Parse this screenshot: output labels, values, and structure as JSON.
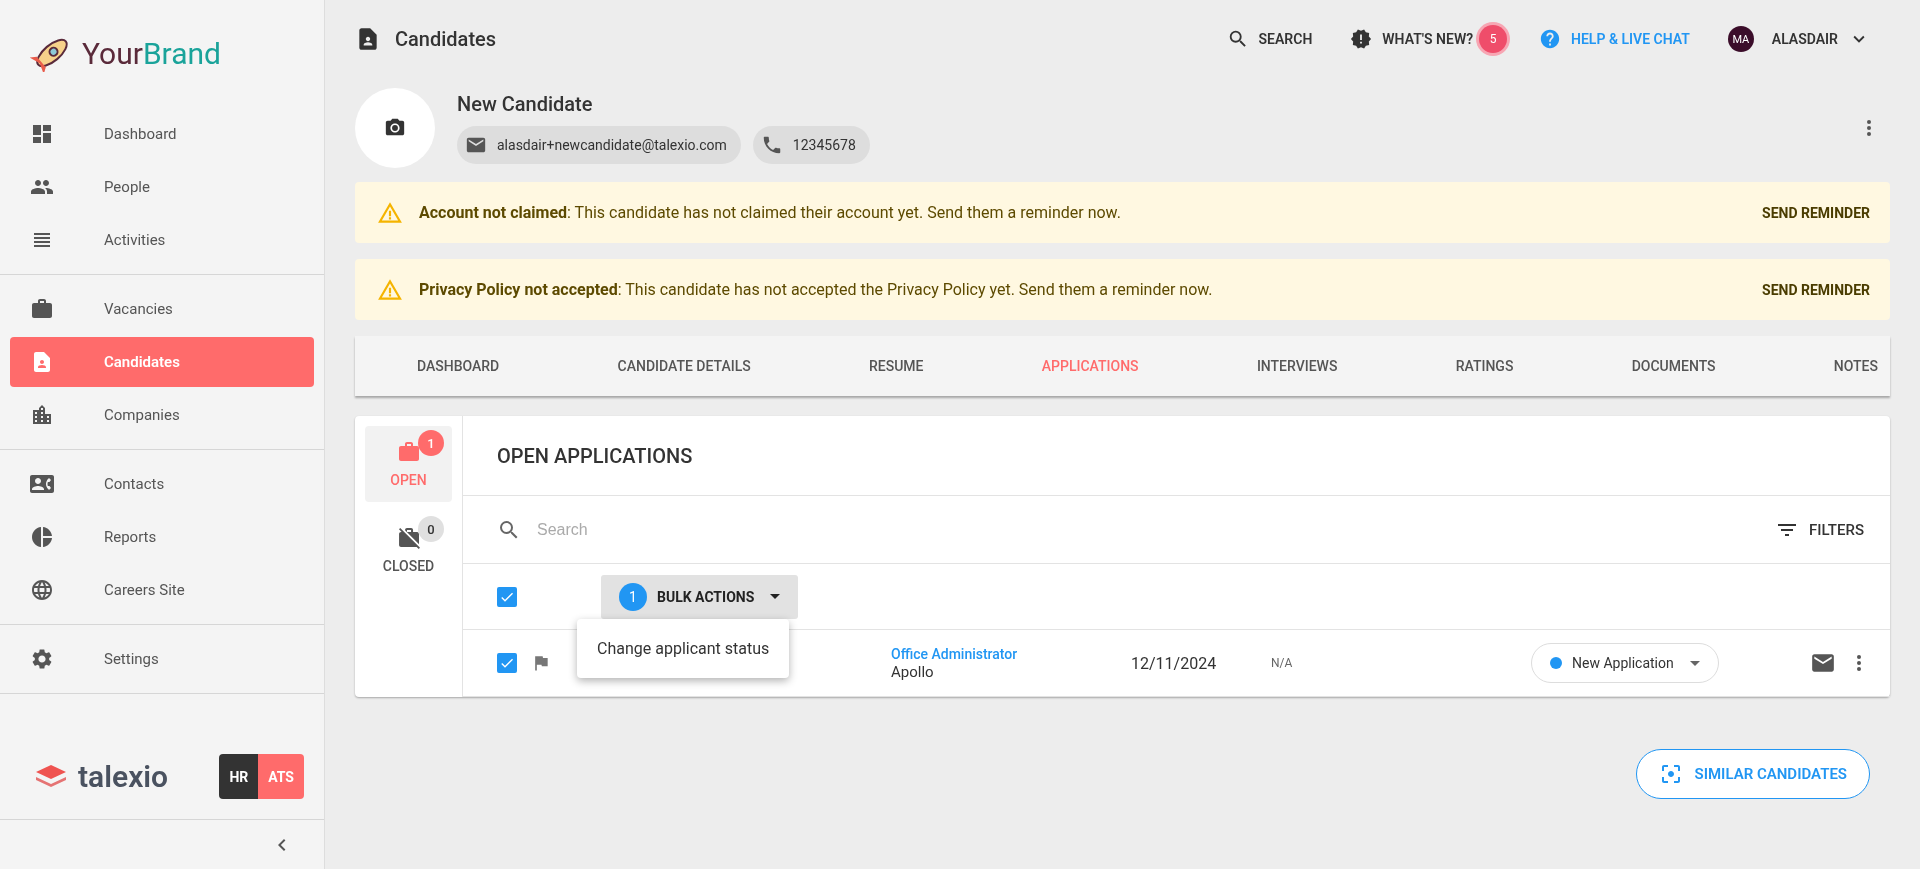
{
  "brand": {
    "name_first": "Your",
    "name_second": "Brand"
  },
  "sidebar": {
    "groups": [
      [
        {
          "label": "Dashboard",
          "selected": false
        },
        {
          "label": "People",
          "selected": false
        },
        {
          "label": "Activities",
          "selected": false
        }
      ],
      [
        {
          "label": "Vacancies",
          "selected": false
        },
        {
          "label": "Candidates",
          "selected": true
        },
        {
          "label": "Companies",
          "selected": false
        }
      ],
      [
        {
          "label": "Contacts",
          "selected": false
        },
        {
          "label": "Reports",
          "selected": false
        },
        {
          "label": "Careers Site",
          "selected": false
        }
      ],
      [
        {
          "label": "Settings",
          "selected": false
        }
      ]
    ],
    "footer_logo": "talexio",
    "modes": [
      {
        "label": "HR",
        "selected": false
      },
      {
        "label": "ATS",
        "selected": true
      }
    ]
  },
  "header": {
    "title": "Candidates",
    "search": "SEARCH",
    "whats_new": "WHAT'S NEW?",
    "whats_new_count": "5",
    "help": "HELP & LIVE CHAT",
    "user_initials": "MA",
    "user_name": "ALASDAIR"
  },
  "candidate": {
    "name": "New Candidate",
    "email": "alasdair+newcandidate@talexio.com",
    "phone": "12345678"
  },
  "alerts": [
    {
      "title": "Account not claimed",
      "text": ": This candidate has not claimed their account yet. Send them a reminder now.",
      "action": "SEND REMINDER"
    },
    {
      "title": "Privacy Policy not accepted",
      "text": ": This candidate has not accepted the Privacy Policy yet. Send them a reminder now.",
      "action": "SEND REMINDER"
    }
  ],
  "tabs": [
    {
      "label": "DASHBOARD",
      "selected": false
    },
    {
      "label": "CANDIDATE DETAILS",
      "selected": false
    },
    {
      "label": "RESUME",
      "selected": false
    },
    {
      "label": "APPLICATIONS",
      "selected": true
    },
    {
      "label": "INTERVIEWS",
      "selected": false
    },
    {
      "label": "RATINGS",
      "selected": false
    },
    {
      "label": "DOCUMENTS",
      "selected": false
    },
    {
      "label": "NOTES",
      "selected": false
    }
  ],
  "application_filters": [
    {
      "label": "OPEN",
      "count": "1",
      "selected": true
    },
    {
      "label": "CLOSED",
      "count": "0",
      "selected": false
    }
  ],
  "applications": {
    "title": "OPEN APPLICATIONS",
    "search_placeholder": "Search",
    "filters": "FILTERS",
    "select_all_checked": true,
    "bulk_count": "1",
    "bulk_label": "BULK ACTIONS",
    "bulk_menu": [
      "Change applicant status"
    ],
    "rows": [
      {
        "checked": true,
        "job": "Office Administrator",
        "company": "Apollo",
        "date": "12/11/2024",
        "column_5": "N/A",
        "status": {
          "label": "New Application",
          "color": "#2196f3"
        }
      }
    ]
  },
  "similar": "SIMILAR CANDIDATES"
}
